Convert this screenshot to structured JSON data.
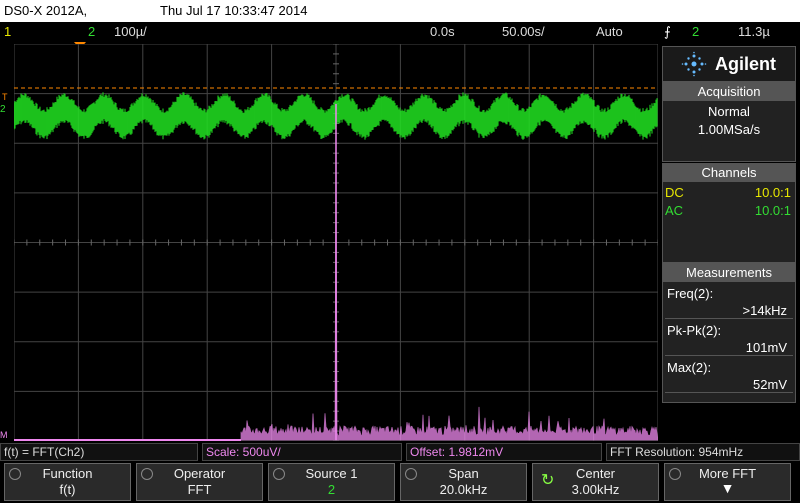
{
  "title": {
    "model": "DS0-X 2012A,",
    "datetime": "Thu Jul 17 10:33:47 2014"
  },
  "status": {
    "ch1": "1",
    "ch2": "2",
    "ch2_scale": "100µ/",
    "time_offset": "0.0s",
    "time_scale": "50.00s/",
    "trigger_mode": "Auto",
    "trigger_channel": "2",
    "trigger_level": "11.3µ",
    "marker_T": "T",
    "marker_2": "2",
    "marker_M": "M"
  },
  "sidebar": {
    "brand": "Agilent",
    "acquisition": {
      "title": "Acquisition",
      "mode": "Normal",
      "rate": "1.00MSa/s"
    },
    "channels": {
      "title": "Channels",
      "rows": [
        {
          "coupling": "DC",
          "ratio": "10.0:1",
          "color": "#e8e800"
        },
        {
          "coupling": "AC",
          "ratio": "10.0:1",
          "color": "#33dd33"
        }
      ]
    },
    "measurements": {
      "title": "Measurements",
      "items": [
        {
          "label": "Freq(2):",
          "value": ">14kHz"
        },
        {
          "label": "Pk-Pk(2):",
          "value": "101mV"
        },
        {
          "label": "Max(2):",
          "value": "52mV"
        }
      ]
    }
  },
  "fft_bar": {
    "function": "f(t) = FFT(Ch2)",
    "scale": "Scale: 500uV/",
    "offset": "Offset: 1.9812mV",
    "resolution": "FFT Resolution: 954mHz"
  },
  "softkeys": [
    {
      "top": "Function",
      "bottom": "f(t)"
    },
    {
      "top": "Operator",
      "bottom": "FFT"
    },
    {
      "top": "Source 1",
      "bottom": "2"
    },
    {
      "top": "Span",
      "bottom": "20.0kHz"
    },
    {
      "top": "Center",
      "bottom": "3.00kHz"
    },
    {
      "top": "More FFT",
      "bottom": ""
    }
  ],
  "colors": {
    "ch1": "#e8e800",
    "ch2": "#33dd33",
    "math": "#ee88ee",
    "trigger_marker": "#ff8800",
    "grid": "#555555"
  }
}
